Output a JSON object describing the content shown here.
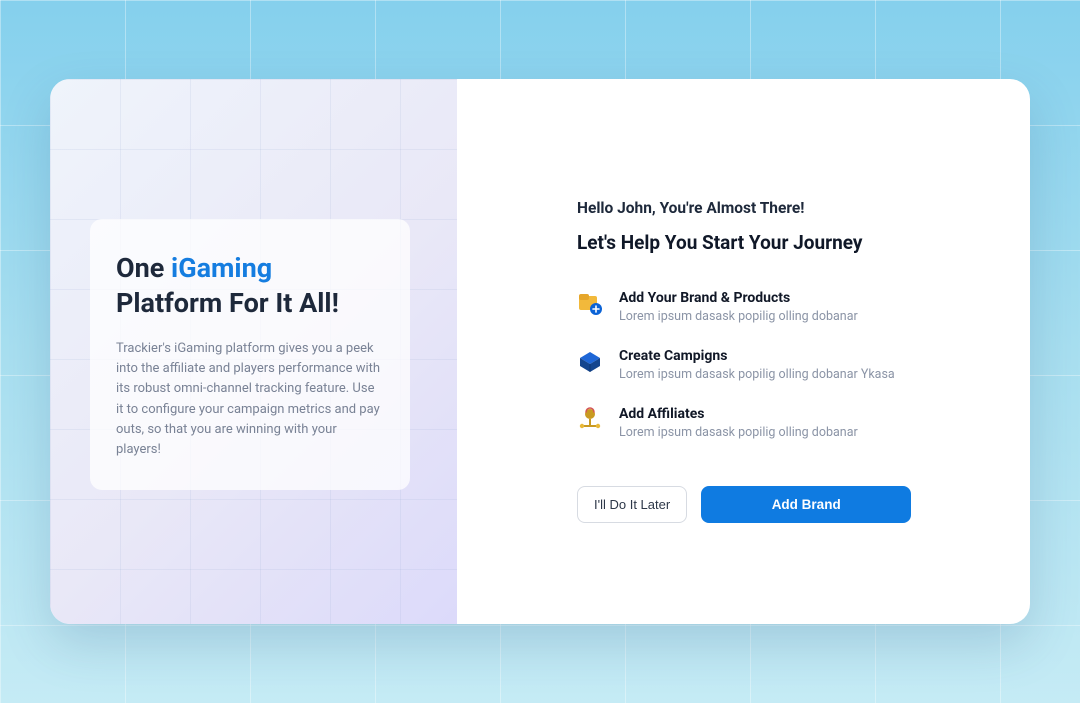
{
  "hero": {
    "title_prefix": "One ",
    "title_accent": "iGaming",
    "title_suffix": " Platform For It All!",
    "body": "Trackier's iGaming platform gives you a peek into the affiliate and players performance with its robust omni-channel tracking feature. Use it to configure your campaign metrics and pay outs, so that you are winning with your players!"
  },
  "right": {
    "greeting": "Hello John, You're Almost There!",
    "subheading": "Let's Help You Start Your Journey",
    "steps": [
      {
        "title": "Add Your Brand & Products",
        "desc": "Lorem ipsum dasask popilig olling dobanar"
      },
      {
        "title": "Create Campigns",
        "desc": "Lorem ipsum dasask popilig olling dobanar Ykasa"
      },
      {
        "title": "Add Affiliates",
        "desc": "Lorem ipsum dasask popilig olling dobanar"
      }
    ]
  },
  "actions": {
    "later": "I'll Do It Later",
    "primary": "Add Brand"
  },
  "colors": {
    "accent": "#0f7be1"
  }
}
